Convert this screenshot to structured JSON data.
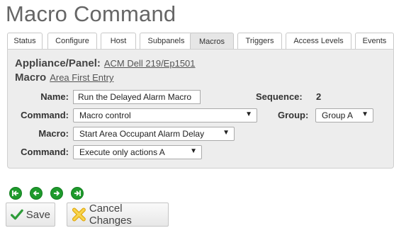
{
  "page_title": "Macro Command",
  "tabs": [
    {
      "label": "Status"
    },
    {
      "label": "Configure"
    },
    {
      "label": "Host"
    },
    {
      "label": "Subpanels"
    },
    {
      "label": "Macros",
      "active": true
    },
    {
      "label": "Triggers"
    },
    {
      "label": "Access Levels"
    },
    {
      "label": "Events"
    }
  ],
  "panel": {
    "appliance_label": "Appliance/Panel:",
    "appliance_value": "ACM Dell 219/Ep1501",
    "macro_label": "Macro",
    "macro_value": "Area First Entry"
  },
  "form": {
    "name_label": "Name:",
    "name_value": "Run the Delayed Alarm Macro",
    "sequence_label": "Sequence:",
    "sequence_value": "2",
    "command_label": "Command:",
    "command_value": "Macro control",
    "group_label": "Group:",
    "group_value": "Group A",
    "macro_label": "Macro:",
    "macro_value": "Start Area Occupant Alarm Delay",
    "command2_label": "Command:",
    "command2_value": "Execute only actions A"
  },
  "buttons": {
    "save": "Save",
    "cancel": "Cancel Changes"
  },
  "colors": {
    "nav_green": "#1e9a2c",
    "save_check": "#2e9c3a",
    "cancel_x": "#f0c020"
  }
}
